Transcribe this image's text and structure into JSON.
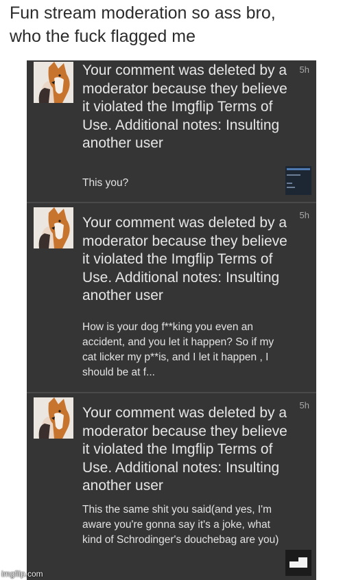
{
  "caption": "Fun stream moderation so ass bro,\nwho the fuck flagged me",
  "notifications": [
    {
      "time": "5h",
      "message": "Your comment was deleted by a moderator because they believe it violated the Imgflip Terms of Use. Additional notes: Insulting another user",
      "preview": "This you?",
      "thumbnail_text": "you're douchebag"
    },
    {
      "time": "5h",
      "message": "Your comment was deleted by a moderator because they believe it violated the Imgflip Terms of Use. Additional notes: Insulting another user",
      "preview": "How is your dog f**king you even an accident, and you let it happen? So if my cat licker my p**is, and I let it happen , I should be at f..."
    },
    {
      "time": "5h",
      "message": "Your comment was deleted by a moderator because they believe it violated the Imgflip Terms of Use. Additional notes: Insulting another user",
      "preview": "This the same shit you said(and yes, I'm aware you're gonna say it's a joke, what kind of Schrodinger's douchebag are you)"
    }
  ],
  "watermark": "imgflip.com",
  "colors": {
    "panel": "#353535",
    "text": "#e6e6e6",
    "muted": "#a9a9a9"
  }
}
